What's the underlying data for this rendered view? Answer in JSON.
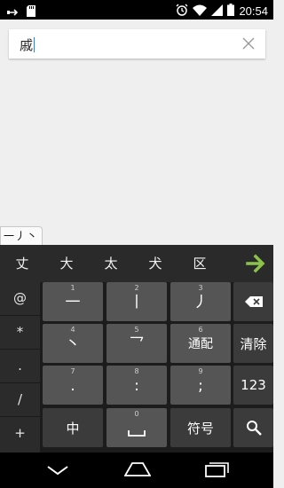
{
  "status_bar": {
    "time": "20:54",
    "left_icons": [
      "usb-icon",
      "sd-card-icon"
    ],
    "right_icons": [
      "alarm-icon",
      "wifi-icon",
      "signal-icon",
      "battery-icon"
    ]
  },
  "search": {
    "value": "戚",
    "clear_icon": "close-icon"
  },
  "composing": {
    "text": "一丿丶"
  },
  "candidates": {
    "items": [
      "丈",
      "大",
      "太",
      "犬",
      "区"
    ],
    "next_icon": "arrow-right-icon",
    "accent_color": "#8bc34a"
  },
  "symbols": [
    "@",
    "*",
    ".",
    "/",
    "+"
  ],
  "keys": {
    "row1": [
      {
        "num": "1",
        "glyph": "一"
      },
      {
        "num": "2",
        "glyph": "丨"
      },
      {
        "num": "3",
        "glyph": "丿"
      }
    ],
    "row2": [
      {
        "num": "4",
        "glyph": "丶"
      },
      {
        "num": "5",
        "glyph": "乛"
      },
      {
        "num": "6",
        "glyph": "通配"
      }
    ],
    "row3": [
      {
        "num": "7",
        "glyph": "."
      },
      {
        "num": "8",
        "glyph": ":"
      },
      {
        "num": "9",
        "glyph": ";"
      }
    ],
    "row4": [
      {
        "num": "",
        "glyph": "中"
      },
      {
        "num": "0",
        "glyph": "space"
      },
      {
        "num": "",
        "glyph": "符号"
      }
    ],
    "right": {
      "backspace_icon": "backspace-icon",
      "clear": "清除",
      "numbers": "123",
      "search_icon": "search-icon"
    }
  },
  "nav": {
    "back_icon": "back-chevron-icon",
    "home_icon": "home-icon",
    "recents_icon": "recents-icon"
  }
}
